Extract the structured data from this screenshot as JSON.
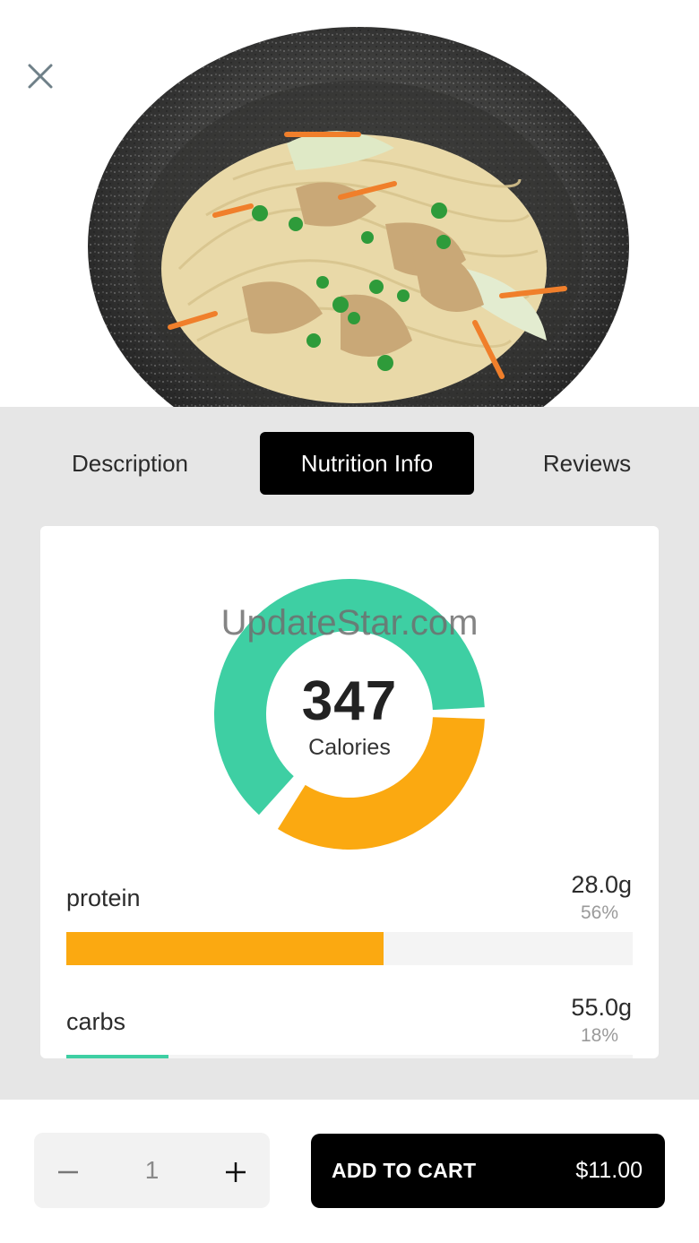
{
  "hero": {
    "image": "noodle-bowl-photo"
  },
  "close": {
    "icon": "close-icon"
  },
  "tabs": [
    {
      "label": "Description",
      "active": false
    },
    {
      "label": "Nutrition Info",
      "active": true
    },
    {
      "label": "Reviews",
      "active": false
    }
  ],
  "nutrition": {
    "calories": "347",
    "calories_label": "Calories",
    "watermark": "UpdateStar.com",
    "donut_colors": {
      "teal": "#3ecfa3",
      "orange": "#fba911"
    },
    "macros": [
      {
        "name": "protein",
        "amount": "28.0g",
        "percent": "56%",
        "fill": 0.56,
        "color": "#fba911"
      },
      {
        "name": "carbs",
        "amount": "55.0g",
        "percent": "18%",
        "fill": 0.18,
        "color": "#3ecfa3"
      }
    ]
  },
  "order": {
    "decrement_icon": "minus-icon",
    "increment_icon": "plus-icon",
    "quantity": "1",
    "add_to_cart_label": "ADD TO CART",
    "price": "$11.00"
  }
}
